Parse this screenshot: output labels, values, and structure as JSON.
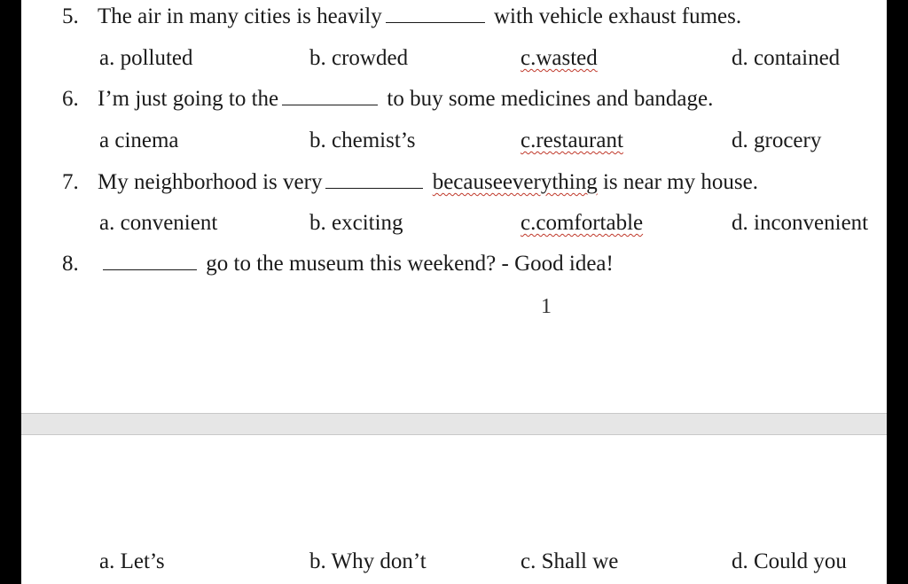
{
  "questions": [
    {
      "number": "5.",
      "stem_before": "The air in many cities is heavily",
      "stem_after": "with vehicle exhaust fumes.",
      "options": [
        "a. polluted",
        "b. crowded",
        "c.wasted",
        "d. contained"
      ]
    },
    {
      "number": "6.",
      "stem_before": "I’m just going to the",
      "stem_after": "to buy some medicines and bandage.",
      "options": [
        "a cinema",
        "b. chemist’s",
        "c.restaurant",
        "d. grocery"
      ]
    },
    {
      "number": "7.",
      "stem_before": "My neighborhood is very",
      "stem_after_squiggle": "becauseeverything",
      "stem_after": "is near my house.",
      "options": [
        "a. convenient",
        "b. exciting",
        "c.comfortable",
        "d. inconvenient"
      ]
    },
    {
      "number": "8.",
      "stem_after": "go to the museum this weekend? - Good idea!",
      "options": [
        "a. Let’s",
        "b. Why don’t",
        "c. Shall we",
        "d. Could you"
      ]
    }
  ],
  "page_number": "1",
  "colors": {
    "background": "#000000",
    "page": "#ffffff",
    "page_gap": "#e6e6e6",
    "spellcheck_squiggle": "#c0392b"
  }
}
